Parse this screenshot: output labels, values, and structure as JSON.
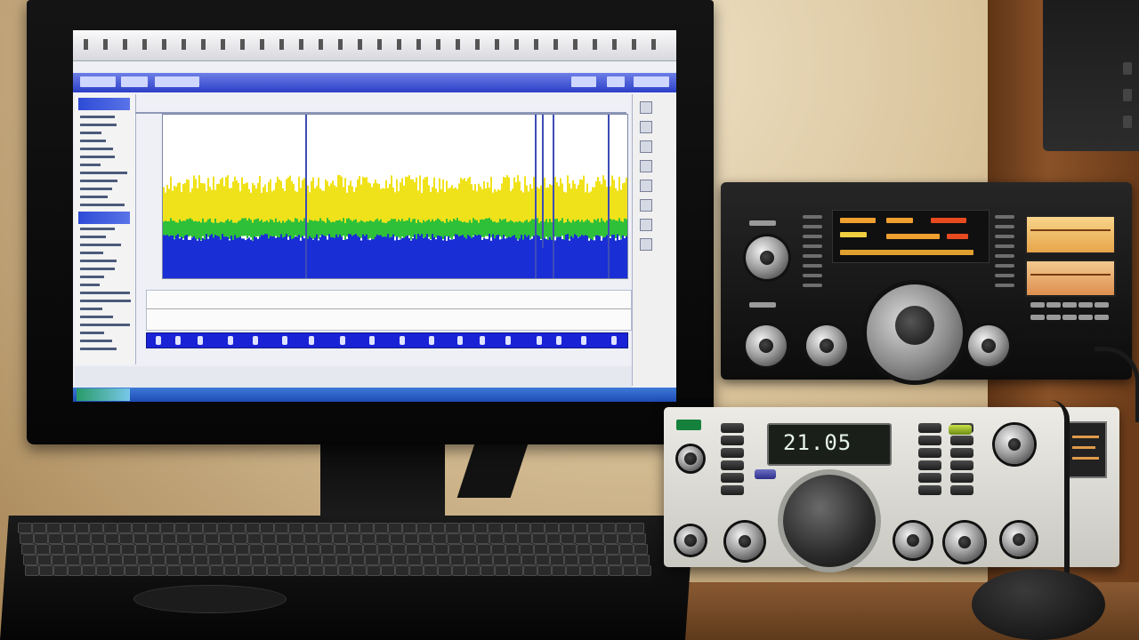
{
  "radio_top": {
    "model_label": "",
    "right_label": ""
  },
  "radio_bottom": {
    "frequency": "21.05"
  },
  "colors": {
    "waterfall_high": "#f0e21a",
    "waterfall_mid": "#2fc03a",
    "waterfall_low": "#1a2ed6",
    "app_titlebar": "#2b3fc8",
    "decoder_bar": "#1a22d6",
    "lcd_text": "#e6f3ea",
    "meter": "#f0c070"
  },
  "icons": {
    "main_tuning_dial": "tuning-dial-icon",
    "power_indicator": "power-led-icon"
  }
}
